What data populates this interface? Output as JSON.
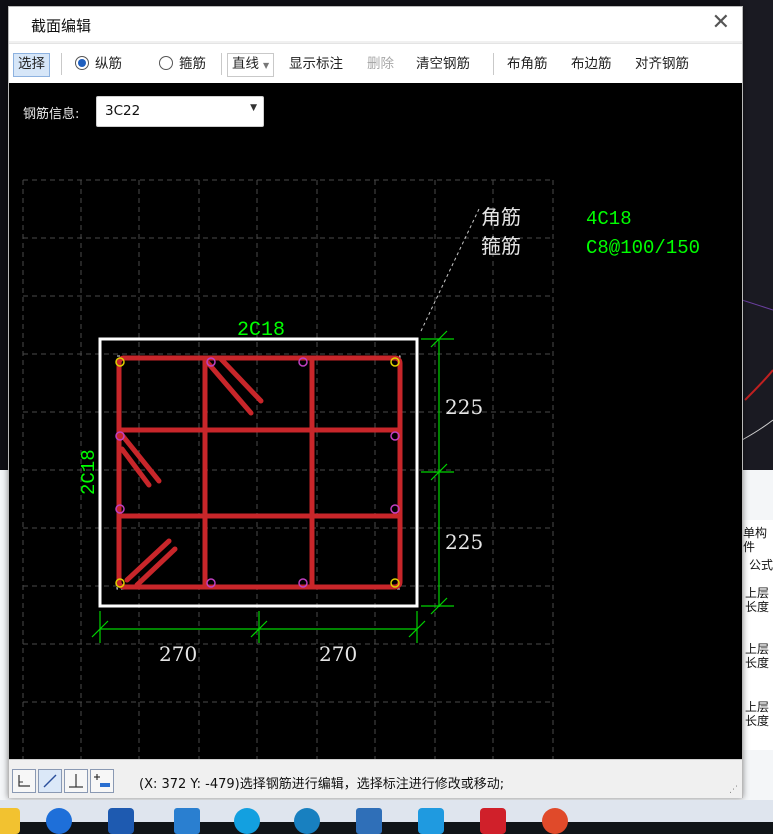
{
  "dialog": {
    "title": "截面编辑"
  },
  "toolbar": {
    "select": "选择",
    "longitudinal": "纵筋",
    "stirrup": "箍筋",
    "line_mode": "直线",
    "show_annotation": "显示标注",
    "delete": "删除",
    "clear_rebar": "清空钢筋",
    "corner_rebar": "布角筋",
    "edge_rebar": "布边筋",
    "align_rebar": "对齐钢筋"
  },
  "rebar_info": {
    "label": "钢筋信息:",
    "value": "3C22"
  },
  "drawing": {
    "legend": {
      "corner_label": "角筋",
      "corner_value": "4C18",
      "stirrup_label": "箍筋",
      "stirrup_value": "C8@100/150"
    },
    "top_rebar": "2C18",
    "left_rebar": "2C18",
    "dim_right_top": "225",
    "dim_right_bottom": "225",
    "dim_bottom_left": "270",
    "dim_bottom_right": "270"
  },
  "status": {
    "text": "(X: 372 Y: -479)选择钢筋进行编辑，选择标注进行修改或移动;"
  },
  "background_panel": {
    "r1": "单构件",
    "r2": "公式",
    "r3a": "上层",
    "r3b": "长度",
    "r4a": "上层",
    "r4b": "长度",
    "r5a": "上层",
    "r5b": "长度"
  },
  "colors": {
    "rebar": "#c8262a",
    "dim_line": "#00d400",
    "text_green": "#00ff00",
    "outline": "#ffffff",
    "corner_dot": "#e0d000",
    "edge_dot": "#c040c0"
  }
}
